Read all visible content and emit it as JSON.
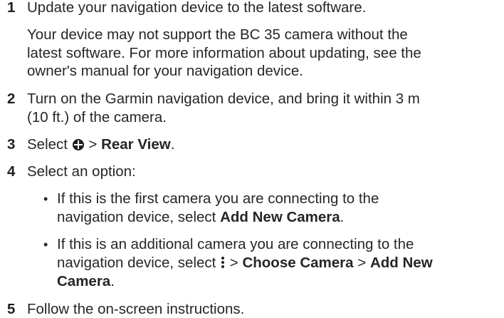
{
  "steps": [
    {
      "number": "1",
      "lines": [
        "Update your navigation device to the latest software."
      ],
      "note": [
        "Your device may not support the BC 35 camera without the",
        "latest software. For more information about updating, see the",
        "owner's manual for your navigation device."
      ]
    },
    {
      "number": "2",
      "lines": [
        "Turn on the Garmin navigation device, and bring it within 3 m",
        "(10 ft.) of the camera."
      ]
    },
    {
      "number": "3",
      "prefix": "Select",
      "sep": ">",
      "target": "Rear View",
      "end": "."
    },
    {
      "number": "4",
      "lines": [
        "Select an option:"
      ],
      "bullets": [
        {
          "lines": [
            "If this is the first camera you are connecting to the",
            "navigation device, select "
          ],
          "bold_end": "Add New Camera",
          "end": "."
        },
        {
          "lines": [
            "If this is an additional camera you are connecting to the",
            "navigation device, select "
          ],
          "sep": ">",
          "bold_1": "Choose Camera",
          "bold_2": "Add New",
          "bold_3": "Camera",
          "end": "."
        }
      ]
    },
    {
      "number": "5",
      "lines": [
        "Follow the on-screen instructions."
      ]
    }
  ],
  "icons": {
    "step3": "apps-grid-icon",
    "bullet2": "menu-kebab-icon"
  },
  "bullet_char": "•"
}
